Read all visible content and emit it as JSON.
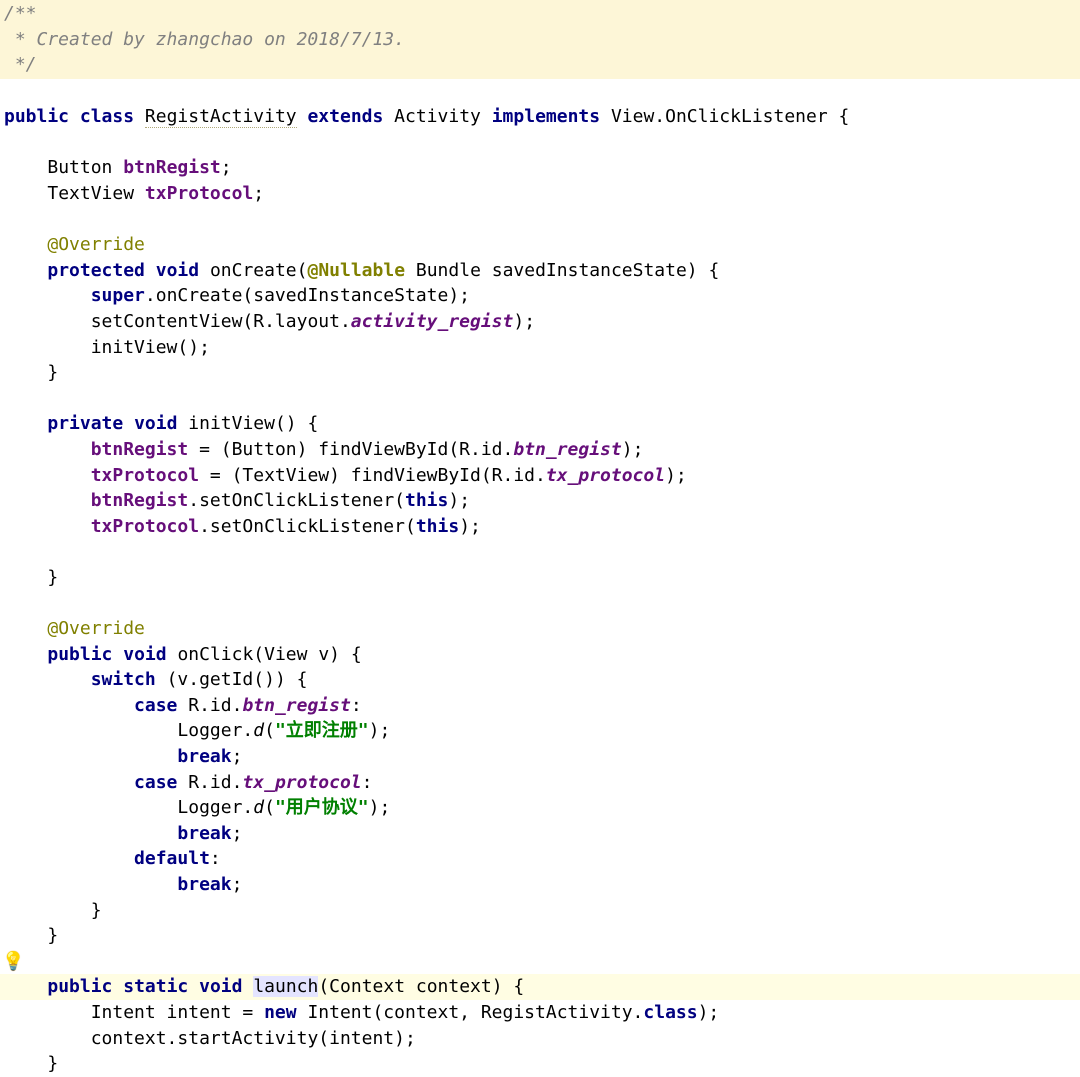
{
  "comment": {
    "l1": "/**",
    "l2": " * Created by zhangchao on 2018/7/13.",
    "l3": " */"
  },
  "code": {
    "classDecl": {
      "public": "public",
      "class": "class",
      "name": "RegistActivity",
      "extends": "extends",
      "superType": "Activity",
      "implements": "implements",
      "iface": "View.OnClickListener {"
    },
    "fields": {
      "btnType": "Button",
      "btnName": "btnRegist",
      "txtType": "TextView",
      "txtName": "txProtocol"
    },
    "override1": "@Override",
    "onCreate": {
      "protected": "protected",
      "void": "void",
      "name": "onCreate(",
      "nullable": "@Nullable",
      "rest": " Bundle savedInstanceState) {",
      "superKw": "super",
      "superCall": ".onCreate(savedInstanceState);",
      "setContentPre": "setContentView(R.layout.",
      "layoutId": "activity_regist",
      "setContentPost": ");",
      "initView": "initView();",
      "close": "}"
    },
    "initView": {
      "private": "private",
      "void": "void",
      "sig": "initView() {",
      "btnAssignPre": " = (Button) findViewById(R.id.",
      "btnId": "btn_regist",
      "post": ");",
      "txAssignPre": " = (TextView) findViewById(R.id.",
      "txId": "tx_protocol",
      "setOCL": ".setOnClickListener(",
      "thisKw": "this",
      "close": "}"
    },
    "override2": "@Override",
    "onClick": {
      "public": "public",
      "void": "void",
      "sig": "onClick(View v) {",
      "switch": "switch",
      "expr": " (v.getId()) {",
      "case": "case",
      "rId": " R.id.",
      "id1": "btn_regist",
      "colon": ":",
      "loggerPre": "Logger.",
      "d": "d",
      "paren": "(",
      "str1": "\"立即注册\"",
      "str2": "\"用户协议\"",
      "endParen": ");",
      "id2": "tx_protocol",
      "breakKw": "break",
      "semi": ";",
      "default": "default",
      "close1": "}",
      "close2": "}"
    },
    "launch": {
      "public": "public",
      "static": "static",
      "void": "void",
      "name": "launch",
      "sig": "(Context context) {",
      "intentLine1a": "Intent intent = ",
      "new": "new",
      "intentLine1b": " Intent(context, RegistActivity.",
      "classKw": "class",
      "intentLine1c": ");",
      "line2": "context.startActivity(intent);",
      "close": "}"
    },
    "blank": " "
  },
  "icons": {
    "bulb": "💡"
  }
}
